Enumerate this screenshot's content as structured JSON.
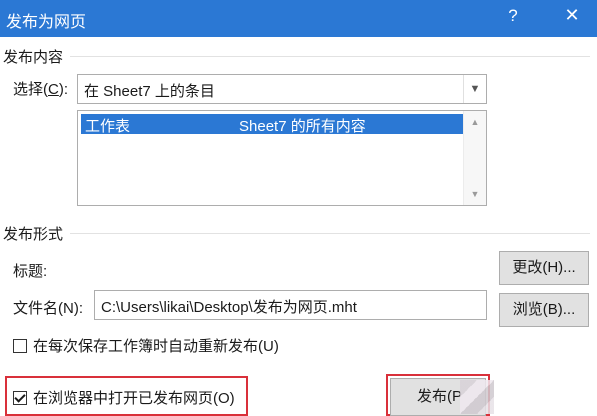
{
  "window": {
    "title": "发布为网页",
    "help_glyph": "?",
    "close_glyph": "✕"
  },
  "section_content": {
    "heading": "发布内容",
    "select_label": "选择(",
    "select_label_key": "C",
    "select_label_end": "):",
    "select_value": "在 Sheet7 上的条目",
    "list": [
      {
        "col1": "工作表",
        "col2": "Sheet7 的所有内容",
        "selected": true
      }
    ]
  },
  "section_format": {
    "heading": "发布形式",
    "title_label": "标题:",
    "change_button": "更改(H)...",
    "filename_label": "文件名(N):",
    "filename_value": "C:\\Users\\likai\\Desktop\\发布为网页.mht",
    "browse_button": "浏览(B)...",
    "autorepublish_label": "在每次保存工作簿时自动重新发布(U)",
    "autorepublish_checked": false,
    "open_in_browser_label": "在浏览器中打开已发布网页(O)",
    "open_in_browser_checked": true
  },
  "buttons": {
    "publish": "发布(P"
  },
  "colors": {
    "titlebar": "#2b78d4",
    "selection": "#2b78d4",
    "highlight_box": "#d9303a"
  }
}
